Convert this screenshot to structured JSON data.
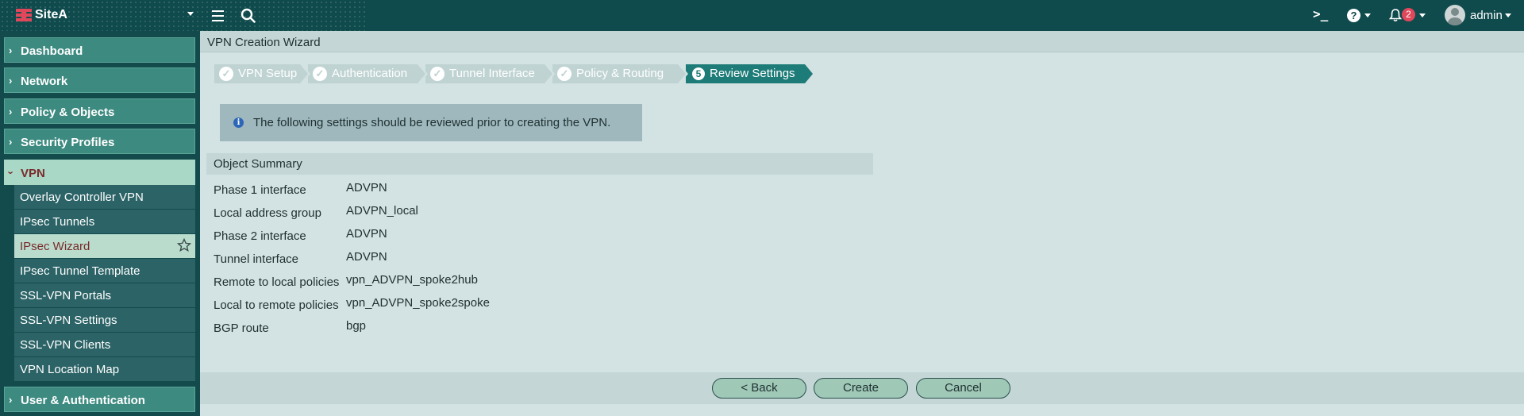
{
  "topbar": {
    "site_name": "SiteA",
    "notification_count": "2",
    "username": "admin",
    "icons": [
      "fortinet-logo-icon",
      "menu-icon",
      "search-icon",
      "cli-console-icon",
      "help-icon",
      "bell-icon",
      "user-avatar-icon"
    ]
  },
  "sidebar": {
    "dashboard": "Dashboard",
    "network": "Network",
    "policy_objects": "Policy & Objects",
    "security_profiles": "Security Profiles",
    "vpn": "VPN",
    "vpn_items": [
      "Overlay Controller VPN",
      "IPsec Tunnels",
      "IPsec Wizard",
      "IPsec Tunnel Template",
      "SSL-VPN Portals",
      "SSL-VPN Settings",
      "SSL-VPN Clients",
      "VPN Location Map"
    ],
    "user_auth": "User & Authentication",
    "active_item": "IPsec Wizard"
  },
  "main": {
    "title": "VPN Creation Wizard",
    "steps": [
      {
        "label": "VPN Setup",
        "state": "done"
      },
      {
        "label": "Authentication",
        "state": "done"
      },
      {
        "label": "Tunnel Interface",
        "state": "done"
      },
      {
        "label": "Policy & Routing",
        "state": "done"
      },
      {
        "label": "Review Settings",
        "state": "current",
        "number": "5"
      }
    ],
    "info_message": "The following settings should be reviewed prior to creating the VPN.",
    "summary_title": "Object Summary",
    "summary": [
      {
        "key": "Phase 1 interface",
        "value": "ADVPN"
      },
      {
        "key": "Local address group",
        "value": "ADVPN_local"
      },
      {
        "key": "Phase 2 interface",
        "value": "ADVPN"
      },
      {
        "key": "Tunnel interface",
        "value": "ADVPN"
      },
      {
        "key": "Remote to local policies",
        "value": "vpn_ADVPN_spoke2hub"
      },
      {
        "key": "Local to remote policies",
        "value": "vpn_ADVPN_spoke2spoke"
      },
      {
        "key": "BGP route",
        "value": "bgp"
      }
    ],
    "buttons": {
      "back": "< Back",
      "create": "Create",
      "cancel": "Cancel"
    }
  },
  "colors": {
    "topbar_bg": "#0f4a4c",
    "sidebar_bg": "#134a4c",
    "content_bg": "#d3e2e2",
    "step_current": "#1d7b78",
    "button_bg": "#9fc8b7",
    "badge_red": "#e0475b",
    "vpn_text": "#7b2a2a"
  }
}
